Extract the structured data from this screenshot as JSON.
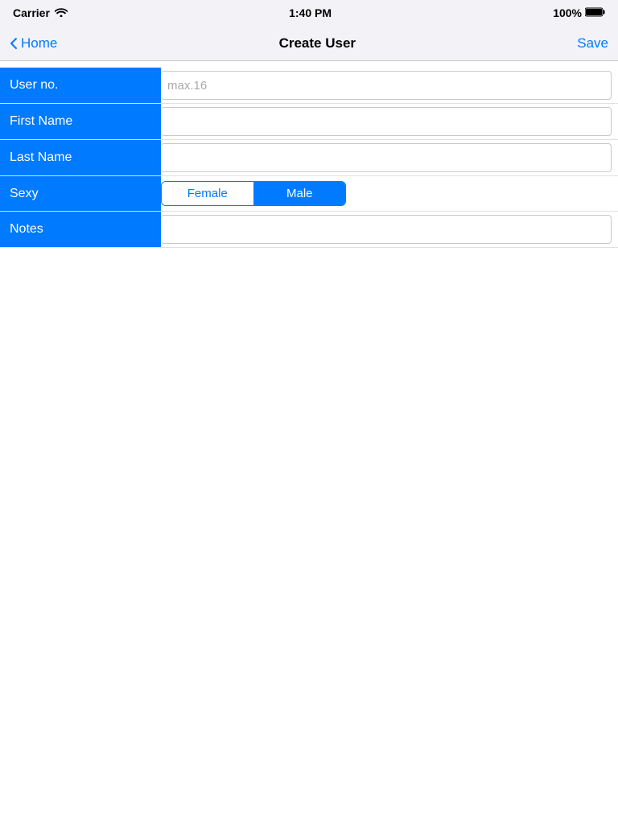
{
  "statusBar": {
    "carrier": "Carrier",
    "time": "1:40 PM",
    "batteryPercent": "100%"
  },
  "navBar": {
    "backLabel": "Home",
    "title": "Create User",
    "saveLabel": "Save"
  },
  "form": {
    "fields": [
      {
        "id": "user-no",
        "label": "User no.",
        "type": "text",
        "placeholder": "max.16",
        "value": ""
      },
      {
        "id": "first-name",
        "label": "First Name",
        "type": "text",
        "placeholder": "",
        "value": ""
      },
      {
        "id": "last-name",
        "label": "Last Name",
        "type": "text",
        "placeholder": "",
        "value": ""
      }
    ],
    "sexyField": {
      "label": "Sexy",
      "options": [
        "Female",
        "Male"
      ],
      "selected": 1
    },
    "notesField": {
      "label": "Notes",
      "placeholder": "",
      "value": ""
    }
  }
}
